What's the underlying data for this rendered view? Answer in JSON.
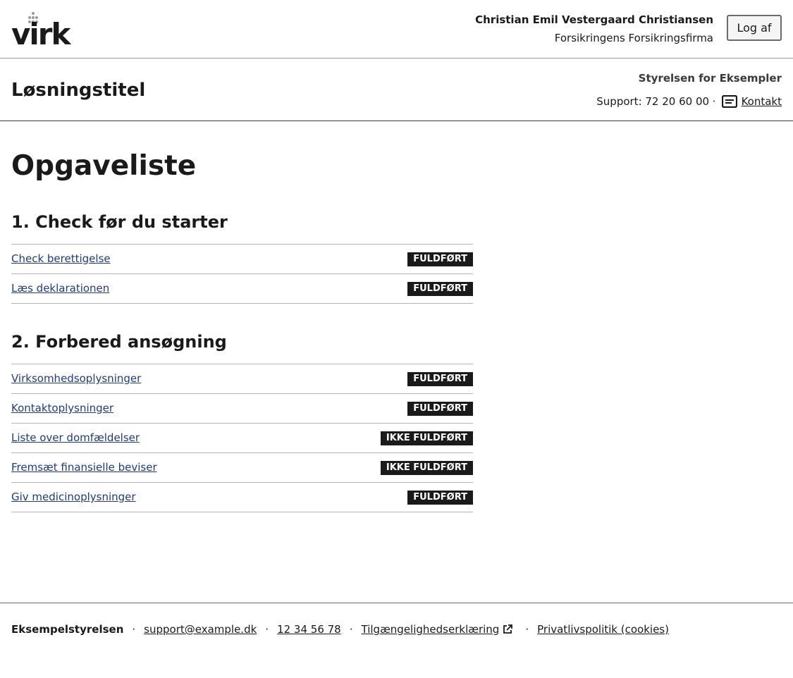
{
  "header": {
    "logo_text": "virk",
    "user_name": "Christian Emil Vestergaard Christiansen",
    "user_org": "Forsikringens Forsikringsfirma",
    "logout_label": "Log af"
  },
  "solution": {
    "title": "Løsningstitel",
    "authority": "Styrelsen for Eksempler",
    "support_text": "Support: 72 20 60 00 ·",
    "contact_label": "Kontakt"
  },
  "main": {
    "page_title": "Opgaveliste",
    "sections": [
      {
        "heading": "1. Check før du starter",
        "tasks": [
          {
            "label": "Check berettigelse",
            "status": "FULDFØRT"
          },
          {
            "label": "Læs deklarationen",
            "status": "FULDFØRT"
          }
        ]
      },
      {
        "heading": "2. Forbered ansøgning",
        "tasks": [
          {
            "label": "Virksomhedsoplysninger",
            "status": "FULDFØRT"
          },
          {
            "label": "Kontaktoplysninger",
            "status": "FULDFØRT"
          },
          {
            "label": "Liste over domfældelser",
            "status": "IKKE FULDFØRT"
          },
          {
            "label": "Fremsæt finansielle beviser",
            "status": "IKKE FULDFØRT"
          },
          {
            "label": "Giv medicinoplysninger",
            "status": "FULDFØRT"
          }
        ]
      }
    ]
  },
  "footer": {
    "org": "Eksempelstyrelsen",
    "separator": "·",
    "email": "support@example.dk",
    "phone": "12 34 56 78",
    "accessibility": "Tilgængelighedserklæring",
    "privacy": "Privatlivspolitik (cookies)"
  },
  "colors": {
    "link": "#1f3b84",
    "tag_bg": "#1a1a1a",
    "tag_text": "#ffffff",
    "divider": "#b5b5b5"
  },
  "icons": {
    "logo_dots": "dot-grid-icon",
    "contact": "message-icon",
    "external": "external-link-icon"
  }
}
